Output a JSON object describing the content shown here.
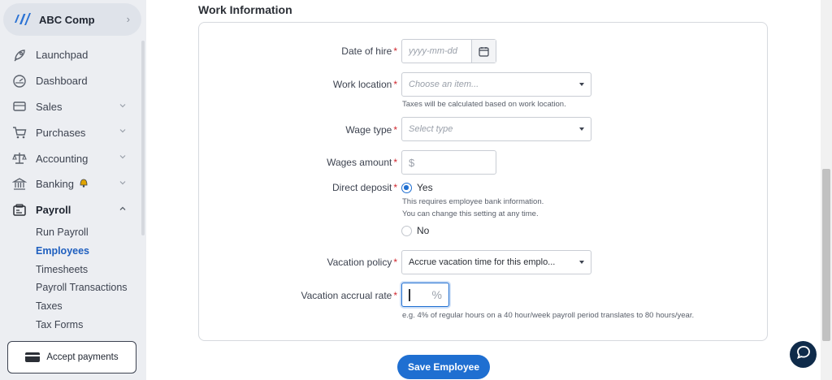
{
  "sidebar": {
    "company": {
      "name": "ABC Comp"
    },
    "items": [
      {
        "label": "Launchpad"
      },
      {
        "label": "Dashboard"
      },
      {
        "label": "Sales"
      },
      {
        "label": "Purchases"
      },
      {
        "label": "Accounting"
      },
      {
        "label": "Banking"
      },
      {
        "label": "Payroll"
      }
    ],
    "payroll_sub": [
      {
        "label": "Run Payroll"
      },
      {
        "label": "Employees"
      },
      {
        "label": "Timesheets"
      },
      {
        "label": "Payroll Transactions"
      },
      {
        "label": "Taxes"
      },
      {
        "label": "Tax Forms"
      }
    ],
    "accept_payments": "Accept payments"
  },
  "form": {
    "section_title": "Work Information",
    "date_of_hire": {
      "label": "Date of hire",
      "placeholder": "yyyy-mm-dd"
    },
    "work_location": {
      "label": "Work location",
      "placeholder": "Choose an item...",
      "help": "Taxes will be calculated based on work location."
    },
    "wage_type": {
      "label": "Wage type",
      "placeholder": "Select type"
    },
    "wages_amount": {
      "label": "Wages amount",
      "prefix": "$"
    },
    "direct_deposit": {
      "label": "Direct deposit",
      "yes": "Yes",
      "no": "No",
      "selected": "Yes",
      "help_line1": "This requires employee bank information.",
      "help_line2": "You can change this setting at any time."
    },
    "vacation_policy": {
      "label": "Vacation policy",
      "value": "Accrue vacation time for this emplo..."
    },
    "vacation_accrual_rate": {
      "label": "Vacation accrual rate",
      "suffix": "%",
      "help": "e.g. 4% of regular hours on a 40 hour/week payroll period translates to 80 hours/year."
    },
    "required_mark": "*",
    "save_label": "Save Employee"
  },
  "colors": {
    "accent": "#1f6fd1",
    "required": "#d0262e",
    "sidebar_bg": "#eceef2",
    "chat_bg": "#0f2b4a"
  }
}
